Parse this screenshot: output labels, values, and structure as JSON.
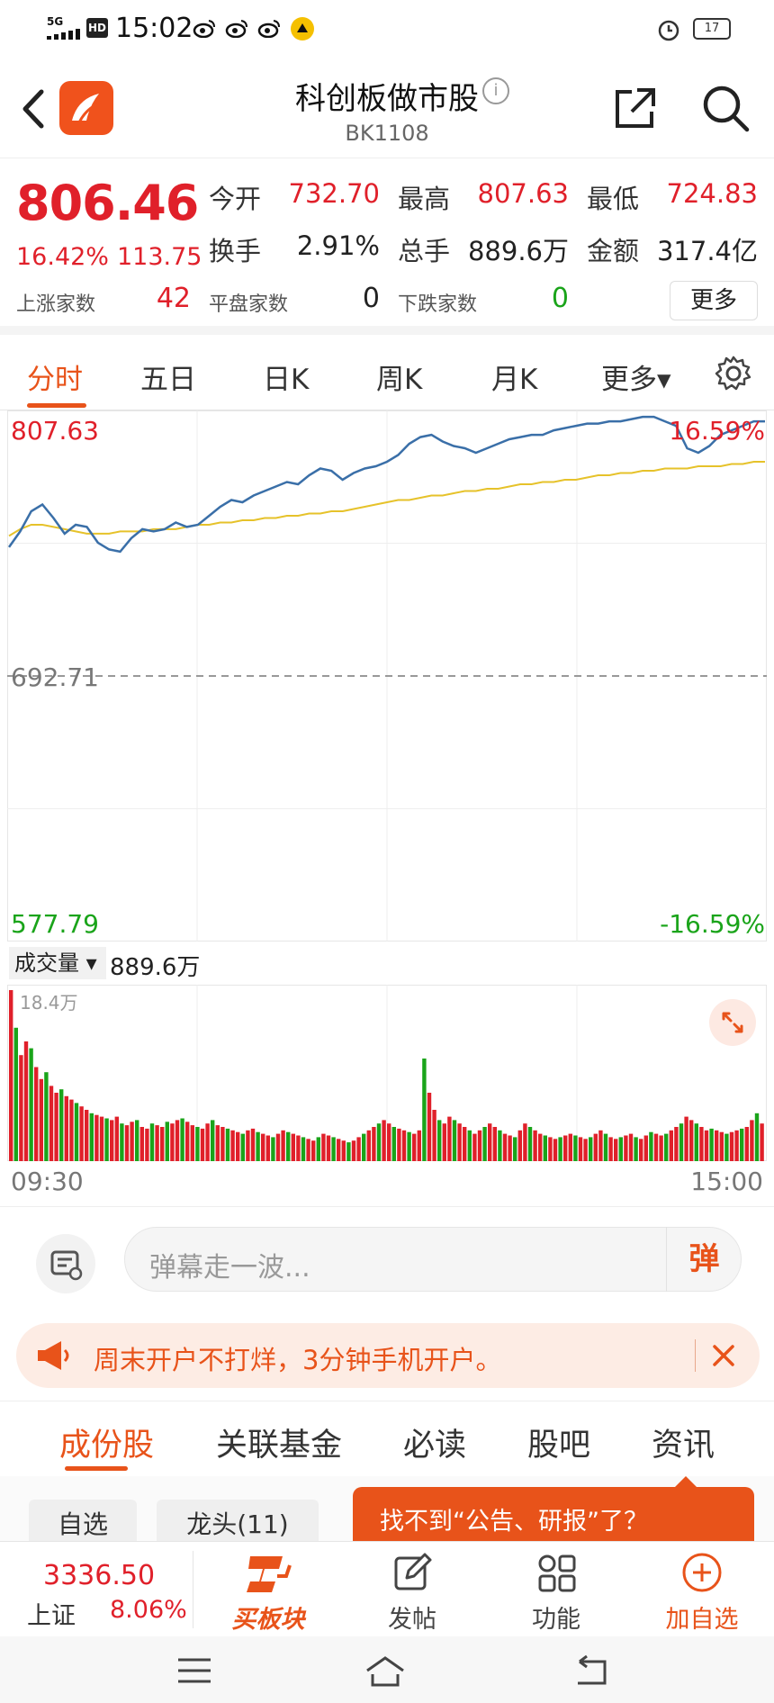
{
  "status_bar": {
    "time": "15:02",
    "network": "5G",
    "hd": "HD",
    "battery": "17"
  },
  "header": {
    "title": "科创板做市股",
    "code": "BK1108",
    "info_glyph": "i"
  },
  "quote": {
    "price": "806.46",
    "change_pct": "16.42%",
    "change_abs": "113.75",
    "open_label": "今开",
    "open": "732.70",
    "high_label": "最高",
    "high": "807.63",
    "low_label": "最低",
    "low": "724.83",
    "turnover_label": "换手",
    "turnover": "2.91%",
    "volume_label": "总手",
    "volume": "889.6万",
    "amount_label": "金额",
    "amount": "317.4亿",
    "up_label": "上涨家数",
    "up_count": "42",
    "flat_label": "平盘家数",
    "flat_count": "0",
    "down_label": "下跌家数",
    "down_count": "0",
    "more_label": "更多"
  },
  "chart_tabs": [
    "分时",
    "五日",
    "日K",
    "周K",
    "月K",
    "更多▾"
  ],
  "chart_labels": {
    "high": "807.63",
    "mid": "692.71",
    "low": "577.79",
    "pct_high": "16.59%",
    "pct_low": "-16.59%",
    "vol_selector": "成交量 ▾",
    "vol_total": "889.6万",
    "vol_max": "18.4万",
    "time_start": "09:30",
    "time_end": "15:00"
  },
  "chart_data": {
    "type": "line",
    "x_range": [
      "09:30",
      "15:00"
    ],
    "ylim": [
      577.79,
      807.63
    ],
    "base": 692.71,
    "series": [
      {
        "values": [
          750,
          757,
          766,
          769,
          763,
          756,
          760,
          759,
          752,
          749,
          748,
          754,
          758,
          757,
          758,
          761,
          759,
          760,
          764,
          768,
          771,
          770,
          773,
          775,
          777,
          779,
          778,
          782,
          785,
          784,
          780,
          783,
          785,
          786,
          788,
          791,
          796,
          799,
          800,
          797,
          795,
          794,
          792,
          794,
          796,
          798,
          799,
          800,
          800,
          802,
          803,
          804,
          805,
          805,
          806,
          806,
          807,
          808,
          808,
          806,
          804,
          794,
          792,
          795,
          800,
          802,
          804,
          806,
          806
        ]
      },
      {
        "values": [
          755,
          758,
          760,
          760,
          759,
          758,
          757,
          756,
          756,
          756,
          757,
          757,
          757,
          758,
          758,
          758,
          759,
          760,
          760,
          761,
          761,
          762,
          762,
          763,
          763,
          764,
          764,
          765,
          765,
          766,
          766,
          767,
          768,
          769,
          770,
          771,
          771,
          772,
          773,
          773,
          774,
          775,
          775,
          776,
          776,
          777,
          778,
          778,
          779,
          779,
          780,
          780,
          781,
          782,
          782,
          783,
          783,
          784,
          784,
          785,
          785,
          785,
          786,
          786,
          786,
          787,
          787,
          788,
          788
        ]
      }
    ]
  },
  "volume_data": {
    "type": "bar",
    "max": "18.4万",
    "values": [
      100,
      78,
      62,
      70,
      66,
      55,
      48,
      52,
      44,
      40,
      42,
      38,
      36,
      34,
      32,
      30,
      28,
      27,
      26,
      25,
      24,
      26,
      22,
      21,
      23,
      24,
      20,
      19,
      22,
      21,
      20,
      23,
      22,
      24,
      25,
      23,
      21,
      20,
      19,
      22,
      24,
      21,
      20,
      19,
      18,
      17,
      16,
      18,
      19,
      17,
      16,
      15,
      14,
      16,
      18,
      17,
      16,
      15,
      14,
      13,
      12,
      14,
      16,
      15,
      14,
      13,
      12,
      11,
      12,
      14,
      16,
      18,
      20,
      22,
      24,
      22,
      20,
      19,
      18,
      17,
      16,
      18,
      60,
      40,
      30,
      24,
      22,
      26,
      24,
      22,
      20,
      18,
      16,
      18,
      20,
      22,
      20,
      18,
      16,
      15,
      14,
      18,
      22,
      20,
      18,
      16,
      15,
      14,
      13,
      14,
      15,
      16,
      15,
      14,
      13,
      14,
      16,
      18,
      16,
      14,
      13,
      14,
      15,
      16,
      14,
      13,
      15,
      17,
      16,
      15,
      16,
      18,
      20,
      22,
      26,
      24,
      22,
      20,
      18,
      19,
      18,
      17,
      16,
      17,
      18,
      19,
      20,
      24,
      28,
      22
    ],
    "colors_pattern": "red-green"
  },
  "danmaku": {
    "placeholder": "弹幕走一波...",
    "send": "弹"
  },
  "promo": {
    "text": "周末开户不打烊，3分钟手机开户。"
  },
  "info_tabs": [
    "成份股",
    "关联基金",
    "必读",
    "股吧",
    "资讯"
  ],
  "filter_chips": [
    "自选",
    "龙头(11)"
  ],
  "tooltip": "找不到“公告、研报”了？",
  "bottom_bar": {
    "index_value": "3336.50",
    "index_name": "上证",
    "index_pct": "8.06%",
    "buy_block": "买板块",
    "post": "发帖",
    "features": "功能",
    "add_watch": "加自选"
  },
  "colors": {
    "up": "#e0202a",
    "down": "#1aa41a",
    "accent": "#e8531a",
    "price_line": "#3a6fa8",
    "avg_line": "#e6c22a"
  }
}
